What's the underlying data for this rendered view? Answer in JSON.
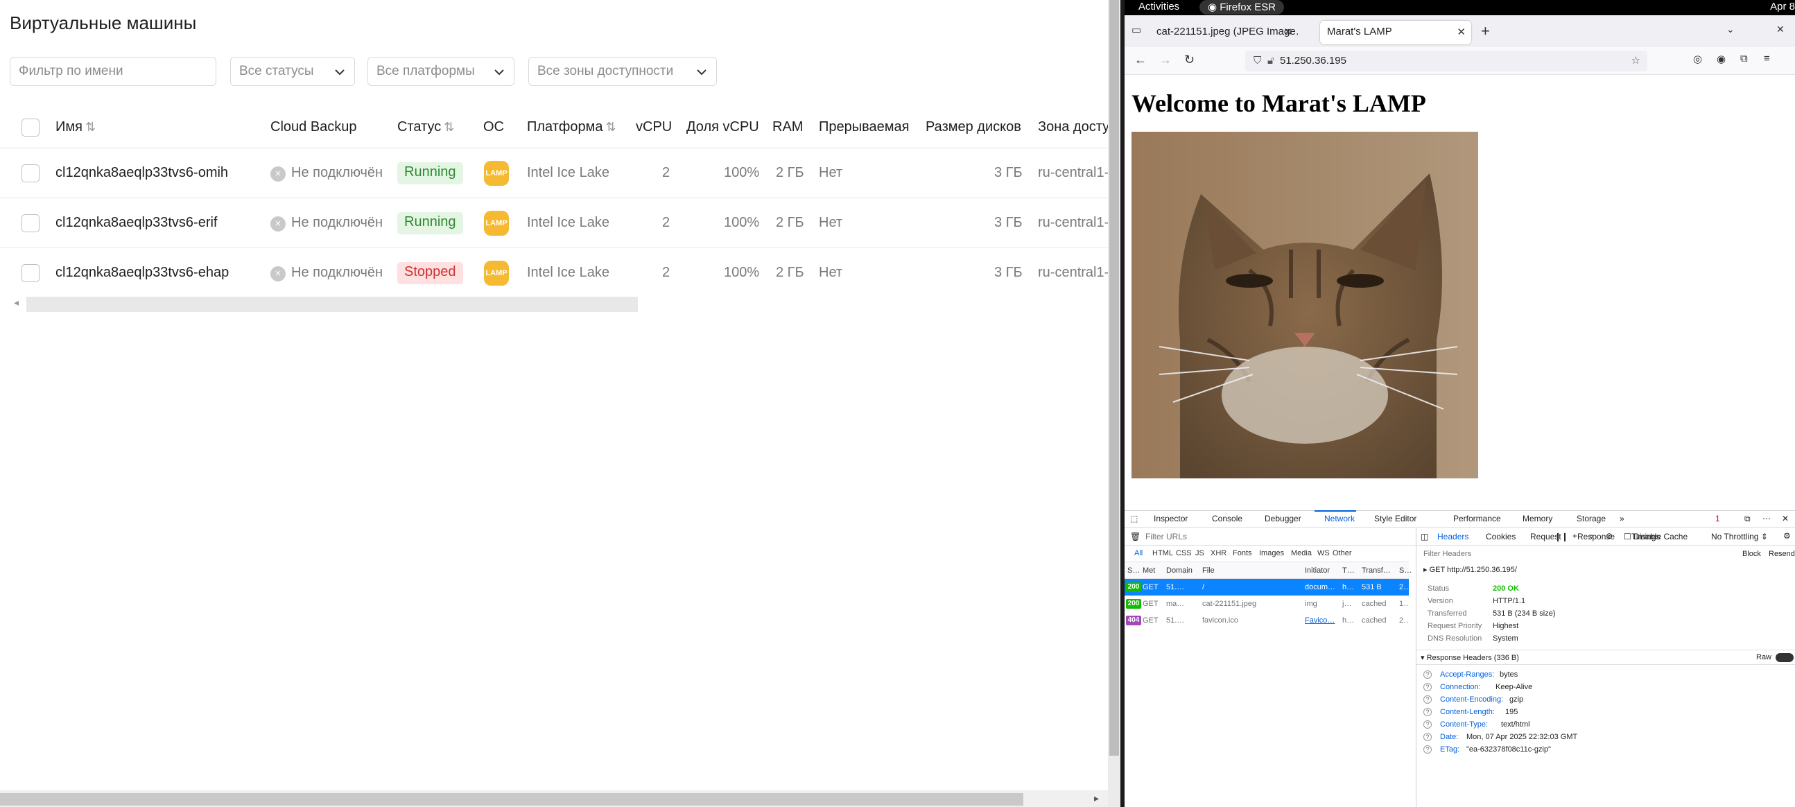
{
  "left_app": {
    "title": "Виртуальные машины",
    "filters": {
      "name_placeholder": "Фильтр по имени",
      "status": "Все статусы",
      "platform": "Все платформы",
      "zone": "Все зоны доступности"
    },
    "columns": [
      "Имя",
      "Cloud Backup",
      "Статус",
      "ОС",
      "Платформа",
      "vCPU",
      "Доля vCPU",
      "RAM",
      "Прерываемая",
      "Размер дисков",
      "Зона досту"
    ],
    "rows": [
      {
        "name": "cl12qnka8aeqlp33tvs6-omih",
        "backup": "Не подключён",
        "status": "Running",
        "os": "LAMP",
        "platform": "Intel Ice Lake",
        "vcpu": "2",
        "share": "100%",
        "ram": "2 ГБ",
        "preempt": "Нет",
        "disk": "3 ГБ",
        "zone": "ru-central1-"
      },
      {
        "name": "cl12qnka8aeqlp33tvs6-erif",
        "backup": "Не подключён",
        "status": "Running",
        "os": "LAMP",
        "platform": "Intel Ice Lake",
        "vcpu": "2",
        "share": "100%",
        "ram": "2 ГБ",
        "preempt": "Нет",
        "disk": "3 ГБ",
        "zone": "ru-central1-"
      },
      {
        "name": "cl12qnka8aeqlp33tvs6-ehap",
        "backup": "Не подключён",
        "status": "Stopped",
        "os": "LAMP",
        "platform": "Intel Ice Lake",
        "vcpu": "2",
        "share": "100%",
        "ram": "2 ГБ",
        "preempt": "Нет",
        "disk": "3 ГБ",
        "zone": "ru-central1-"
      }
    ],
    "colors": {
      "running_bg": "#e4f5e4",
      "running_fg": "#2f8a2f",
      "stopped_bg": "#ffe0e0",
      "stopped_fg": "#cf2f2f",
      "lamp": "#f5b932"
    }
  },
  "gnome": {
    "activities": "Activities",
    "app": "Firefox ESR",
    "date": "Apr 8"
  },
  "browser": {
    "tabs": [
      {
        "label": "cat-221151.jpeg (JPEG Image…",
        "active": false
      },
      {
        "label": "Marat's LAMP",
        "active": true
      }
    ],
    "url": "51.250.36.195",
    "page_heading": "Welcome to Marat's LAMP"
  },
  "devtools": {
    "tools": [
      "Inspector",
      "Console",
      "Debugger",
      "Network",
      "Style Editor",
      "Performance",
      "Memory",
      "Storage"
    ],
    "active_tool": "Network",
    "error_count": "1",
    "filter_placeholder": "Filter URLs",
    "disable_cache": "Disable Cache",
    "throttling": "No Throttling ⇕",
    "types": [
      "All",
      "HTML",
      "CSS",
      "JS",
      "XHR",
      "Fonts",
      "Images",
      "Media",
      "WS",
      "Other"
    ],
    "req_columns": [
      "S…",
      "Met",
      "Domain",
      "File",
      "Initiator",
      "T…",
      "Transf…",
      "S…"
    ],
    "requests": [
      {
        "status": "200",
        "method": "GET",
        "domain": "51.…",
        "file": "/",
        "initiator": "docum…",
        "type": "h…",
        "transferred": "531 B",
        "size": "2…",
        "selected": true,
        "status_color": "#12bc00"
      },
      {
        "status": "200",
        "method": "GET",
        "domain": "ma…",
        "file": "cat-221151.jpeg",
        "initiator": "img",
        "type": "j…",
        "transferred": "cached",
        "size": "1…",
        "selected": false,
        "status_color": "#12bc00"
      },
      {
        "status": "404",
        "method": "GET",
        "domain": "51.…",
        "file": "favicon.ico",
        "initiator": "Favico…",
        "type": "h…",
        "transferred": "cached",
        "size": "2…",
        "selected": false,
        "status_color": "#a347ba"
      }
    ],
    "side_tabs": [
      "Headers",
      "Cookies",
      "Request",
      "Response",
      "Timings"
    ],
    "filter_headers": "Filter Headers",
    "block": "Block",
    "resend": "Resend",
    "get_line": "GET http://51.250.36.195/",
    "summary": [
      {
        "k": "Status",
        "v": "200 OK"
      },
      {
        "k": "Version",
        "v": "HTTP/1.1"
      },
      {
        "k": "Transferred",
        "v": "531 B (234 B size)"
      },
      {
        "k": "Request Priority",
        "v": "Highest"
      },
      {
        "k": "DNS Resolution",
        "v": "System"
      }
    ],
    "response_headers_title": "Response Headers (336 B)",
    "raw": "Raw",
    "response_headers": [
      {
        "k": "Accept-Ranges:",
        "v": "bytes"
      },
      {
        "k": "Connection:",
        "v": "Keep-Alive"
      },
      {
        "k": "Content-Encoding:",
        "v": "gzip"
      },
      {
        "k": "Content-Length:",
        "v": "195"
      },
      {
        "k": "Content-Type:",
        "v": "text/html"
      },
      {
        "k": "Date:",
        "v": "Mon, 07 Apr 2025 22:32:03 GMT"
      },
      {
        "k": "ETag:",
        "v": "\"ea-632378f08c11c-gzip\""
      }
    ]
  }
}
